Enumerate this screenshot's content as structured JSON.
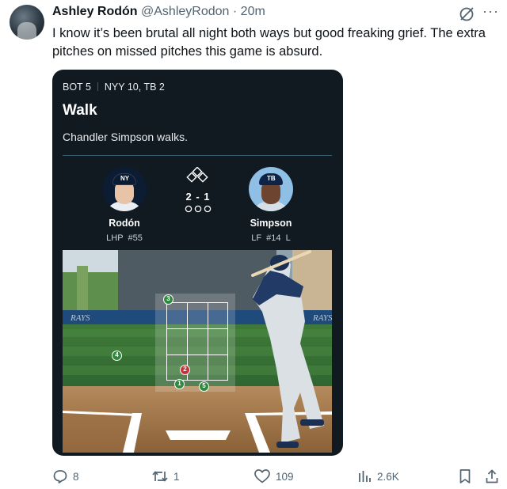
{
  "tweet": {
    "author_name": "Ashley Rodón",
    "handle": "@AshleyRodon",
    "separator": "·",
    "time": "20m",
    "text": "I know it’s been brutal all night both ways but good freaking grief. The extra pitches on missed pitches this game is absurd.",
    "more_glyph": "···"
  },
  "card": {
    "inning": "BOT 5",
    "score": "NYY 10, TB 2",
    "event_title": "Walk",
    "event_desc": "Chandler Simpson walks.",
    "count": "2 - 1",
    "pitcher": {
      "name": "Rodón",
      "info": "LHP  #55",
      "cap_logo": "NY"
    },
    "batter": {
      "name": "Simpson",
      "info": "LF  #14  L",
      "cap_logo": "TB"
    },
    "banner_text_left": "RAYS",
    "banner_text_right": "RAYS",
    "pitches": [
      {
        "num": "1",
        "result": "ball"
      },
      {
        "num": "2",
        "result": "strike"
      },
      {
        "num": "3",
        "result": "ball"
      },
      {
        "num": "4",
        "result": "ball"
      },
      {
        "num": "5",
        "result": "ball"
      }
    ],
    "colors": {
      "card_bg": "#111a21",
      "ball": "#2e8b3e",
      "strike": "#c7323b"
    }
  },
  "actions": {
    "replies": "8",
    "reposts": "1",
    "likes": "109",
    "views": "2.6K"
  }
}
